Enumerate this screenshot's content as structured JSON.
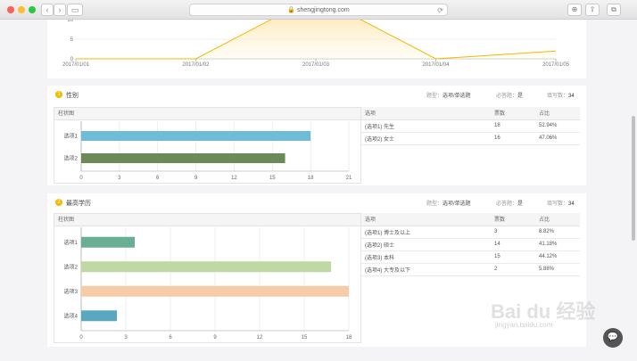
{
  "browser": {
    "url": "shengjingtong.com",
    "reload_icon": "⟳"
  },
  "line_chart": {
    "chart_data": {
      "type": "area",
      "x": [
        "2017/01/01",
        "2017/01/02",
        "2017/01/03",
        "2017/01/04",
        "2017/01/05"
      ],
      "values": [
        0,
        0,
        16,
        0,
        2
      ],
      "ylim": [
        0,
        10
      ],
      "yticks": [
        "10",
        "5",
        "0"
      ],
      "grid": true
    }
  },
  "q1": {
    "num": "1",
    "title": "性别",
    "meta1_label": "题型：",
    "meta1_value": "选项/单选题",
    "meta2_label": "必答题：",
    "meta2_value": "是",
    "meta3_label": "填写数：",
    "meta3_value": "34",
    "chart_head": "柱状图",
    "table_head": {
      "option": "选项",
      "votes": "票数",
      "percent": "占比"
    },
    "rows": [
      {
        "option": "(选项1) 先生",
        "votes": "18",
        "percent": "52.94%"
      },
      {
        "option": "(选项2) 女士",
        "votes": "16",
        "percent": "47.06%"
      }
    ],
    "chart_data": {
      "type": "bar",
      "orientation": "horizontal",
      "categories": [
        "选项1",
        "选项2"
      ],
      "values": [
        18,
        16
      ],
      "colors": [
        "#6ebcd6",
        "#6c8a58"
      ],
      "xlim": [
        0,
        21
      ],
      "xticks": [
        "0",
        "3",
        "6",
        "9",
        "12",
        "15",
        "18",
        "21"
      ]
    }
  },
  "q2": {
    "num": "2",
    "title": "最高学历",
    "meta1_label": "题型：",
    "meta1_value": "选项/单选题",
    "meta2_label": "必答题：",
    "meta2_value": "是",
    "meta3_label": "填写数：",
    "meta3_value": "34",
    "chart_head": "柱状图",
    "table_head": {
      "option": "选项",
      "votes": "票数",
      "percent": "占比"
    },
    "rows": [
      {
        "option": "(选项1) 博士及以上",
        "votes": "3",
        "percent": "8.82%"
      },
      {
        "option": "(选项2) 硕士",
        "votes": "14",
        "percent": "41.18%"
      },
      {
        "option": "(选项3) 本科",
        "votes": "15",
        "percent": "44.12%"
      },
      {
        "option": "(选项4) 大专及以下",
        "votes": "2",
        "percent": "5.88%"
      }
    ],
    "chart_data": {
      "type": "bar",
      "orientation": "horizontal",
      "categories": [
        "选项1",
        "选项2",
        "选项3",
        "选项4"
      ],
      "values": [
        3,
        14,
        15,
        2
      ],
      "colors": [
        "#6aae94",
        "#bfd9a4",
        "#f6cba7",
        "#5aa8c0"
      ],
      "xlim": [
        0,
        15
      ],
      "xticks": [
        "0",
        "3",
        "6",
        "9",
        "12",
        "15",
        "18"
      ]
    }
  },
  "watermark": {
    "text": "Bai du 经验",
    "sub": "jingyan.baidu.com"
  },
  "icons": {
    "chat": "chat-bubble-icon"
  }
}
